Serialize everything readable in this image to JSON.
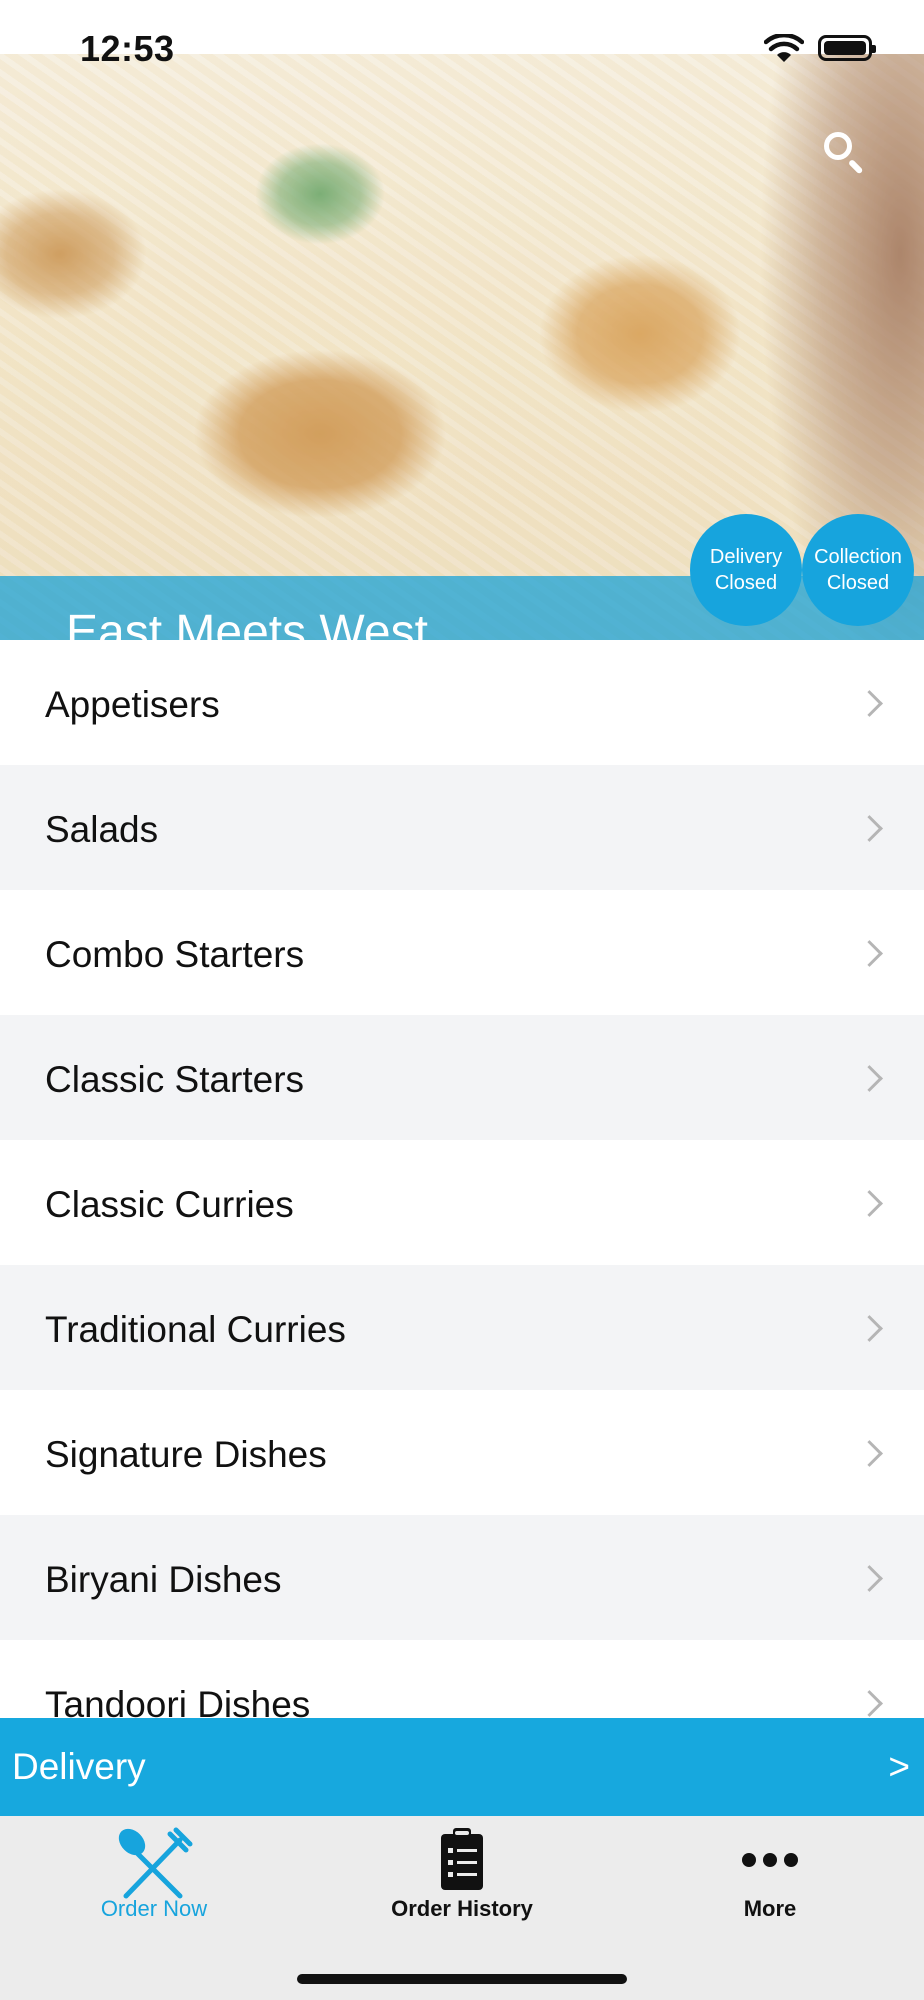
{
  "status_bar": {
    "time": "12:53"
  },
  "hero": {
    "restaurant_name": "East Meets West",
    "delivery_status": {
      "line1": "Delivery",
      "line2": "Closed"
    },
    "collection_status": {
      "line1": "Collection",
      "line2": "Closed"
    }
  },
  "categories": [
    {
      "label": "Appetisers"
    },
    {
      "label": "Salads"
    },
    {
      "label": "Combo Starters"
    },
    {
      "label": "Classic Starters"
    },
    {
      "label": "Classic Curries"
    },
    {
      "label": "Traditional Curries"
    },
    {
      "label": "Signature Dishes"
    },
    {
      "label": "Biryani Dishes"
    },
    {
      "label": "Tandoori Dishes"
    }
  ],
  "delivery_bar": {
    "label": "Delivery",
    "arrow": ">"
  },
  "tab_bar": {
    "tabs": [
      {
        "label": "Order Now",
        "icon": "fork-knife-icon",
        "active": true
      },
      {
        "label": "Order History",
        "icon": "clipboard-list-icon",
        "active": false
      },
      {
        "label": "More",
        "icon": "more-dots-icon",
        "active": false
      }
    ]
  },
  "colors": {
    "accent": "#17A4DD",
    "list_alt_row": "#F3F4F6",
    "tab_bar_bg": "#ECECEC"
  }
}
